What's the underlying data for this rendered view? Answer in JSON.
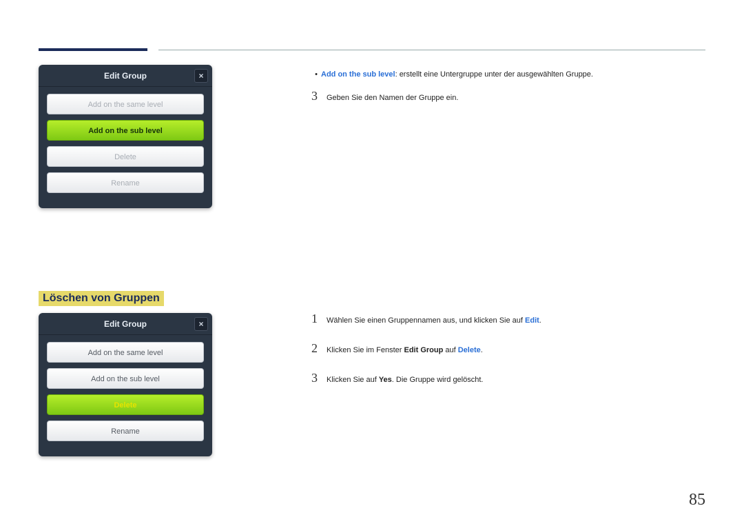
{
  "page_number": "85",
  "dialog1": {
    "title": "Edit Group",
    "close": "×",
    "buttons": {
      "same": "Add on the same level",
      "sub": "Add on the sub level",
      "delete": "Delete",
      "rename": "Rename"
    }
  },
  "dialog2": {
    "title": "Edit Group",
    "close": "×",
    "buttons": {
      "same": "Add on the same level",
      "sub": "Add on the sub level",
      "delete": "Delete",
      "rename": "Rename"
    }
  },
  "section_heading": "Löschen von Gruppen",
  "right_top": {
    "bullet_keyword": "Add on the sub level",
    "bullet_rest": ": erstellt eine Untergruppe unter der ausgewählten Gruppe.",
    "step3_num": "3",
    "step3_text": "Geben Sie den Namen der Gruppe ein."
  },
  "right_bottom": {
    "step1_num": "1",
    "step1_text_a": "Wählen Sie einen Gruppennamen aus, und klicken Sie auf ",
    "step1_kw": "Edit",
    "step1_text_b": ".",
    "step2_num": "2",
    "step2_text_a": "Klicken Sie im Fenster ",
    "step2_kw1": "Edit Group",
    "step2_text_b": " auf ",
    "step2_kw2": "Delete",
    "step2_text_c": ".",
    "step3_num": "3",
    "step3_text_a": "Klicken Sie auf ",
    "step3_kw": "Yes",
    "step3_text_b": ". Die Gruppe wird gelöscht."
  }
}
